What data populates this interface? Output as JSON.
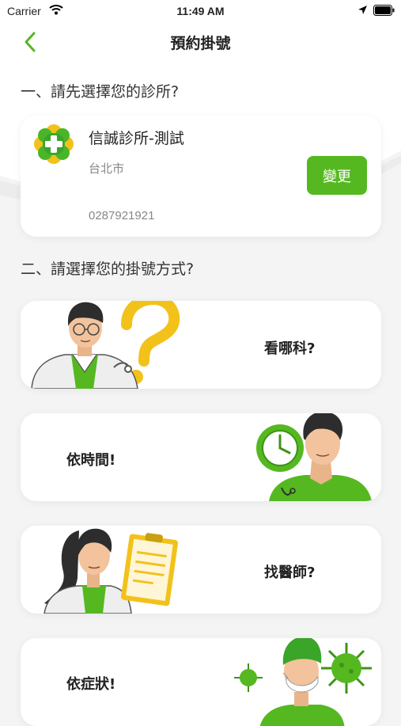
{
  "status_bar": {
    "carrier": "Carrier",
    "time": "11:49 AM"
  },
  "nav": {
    "title": "預約掛號",
    "back_icon": "chevron-left-icon"
  },
  "section1": {
    "title": "一、請先選擇您的診所?"
  },
  "clinic": {
    "name": "信誠診所-測試",
    "city": "台北市",
    "phone": "0287921921",
    "change_label": "變更"
  },
  "section2": {
    "title": "二、請選擇您的掛號方式?"
  },
  "methods": [
    {
      "label": "看哪科?"
    },
    {
      "label": "依時間!"
    },
    {
      "label": "找醫師?"
    },
    {
      "label": "依症狀!"
    }
  ],
  "colors": {
    "accent": "#55b820",
    "background": "#f4f4f4",
    "card": "#ffffff"
  }
}
